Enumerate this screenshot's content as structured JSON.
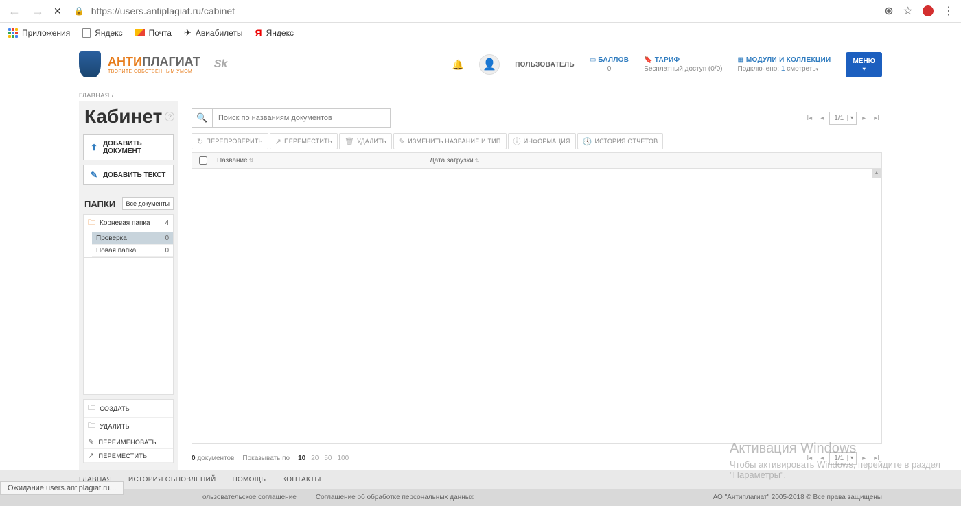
{
  "browser": {
    "url": "https://users.antiplagiat.ru/cabinet",
    "bookmarks": {
      "apps": "Приложения",
      "yandex": "Яндекс",
      "mail": "Почта",
      "avia": "Авиабилеты",
      "yandex2": "Яндекс"
    },
    "status": "Ожидание users.antiplagiat.ru..."
  },
  "logo": {
    "brand1": "АНТИ",
    "brand2": "ПЛАГИАТ",
    "slogan": "ТВОРИТЕ СОБСТВЕННЫМ УМОМ",
    "sk": "Sk"
  },
  "header": {
    "user": "ПОЛЬЗОВАТЕЛЬ",
    "points_label": "БАЛЛОВ",
    "points_value": "0",
    "tariff_label": "ТАРИФ",
    "tariff_value": "Бесплатный доступ (0/0)",
    "modules_label": "МОДУЛИ И КОЛЛЕКЦИИ",
    "modules_value_a": "Подключено: ",
    "modules_value_n": "1",
    "modules_value_b": " смотреть",
    "menu": "МЕНЮ"
  },
  "breadcrumb": "ГЛАВНАЯ /",
  "sidebar": {
    "title": "Кабинет",
    "add_doc": "ДОБАВИТЬ ДОКУМЕНТ",
    "add_text": "ДОБАВИТЬ ТЕКСТ",
    "folders_title": "ПАПКИ",
    "all_docs": "Все документы",
    "root": {
      "name": "Корневая папка",
      "count": "4"
    },
    "check": {
      "name": "Проверка",
      "count": "0"
    },
    "newf": {
      "name": "Новая папка",
      "count": "0"
    },
    "actions": {
      "create": "СОЗДАТЬ",
      "delete": "УДАЛИТЬ",
      "rename": "ПЕРЕИМЕНОВАТЬ",
      "move": "ПЕРЕМЕСТИТЬ"
    }
  },
  "search": {
    "placeholder": "Поиск по названиям документов"
  },
  "pager": {
    "value": "1/1"
  },
  "toolbar": {
    "recheck": "ПЕРЕПРОВЕРИТЬ",
    "move": "ПЕРЕМЕСТИТЬ",
    "delete": "УДАЛИТЬ",
    "rename": "ИЗМЕНИТЬ НАЗВАНИЕ И ТИП",
    "info": "ИНФОРМАЦИЯ",
    "history": "ИСТОРИЯ ОТЧЕТОВ"
  },
  "table": {
    "col_name": "Название",
    "col_date": "Дата загрузки"
  },
  "bottom": {
    "count_n": "0",
    "count_lbl": " документов",
    "show_lbl": "Показывать по",
    "p10": "10",
    "p20": "20",
    "p50": "50",
    "p100": "100"
  },
  "footer1": {
    "main": "ГЛАВНАЯ",
    "history": "ИСТОРИЯ ОБНОВЛЕНИЙ",
    "help": "ПОМОЩЬ",
    "contacts": "КОНТАКТЫ"
  },
  "footer2": {
    "agree": "ользовательское соглашение",
    "pd": "Соглашение об обработке персональных данных",
    "copy": "АО \"Антиплагиат\" 2005-2018 © Все права защищены"
  },
  "watermark": {
    "l1": "Активация Windows",
    "l2": "Чтобы активировать Windows, перейдите в раздел",
    "l3": "\"Параметры\"."
  }
}
